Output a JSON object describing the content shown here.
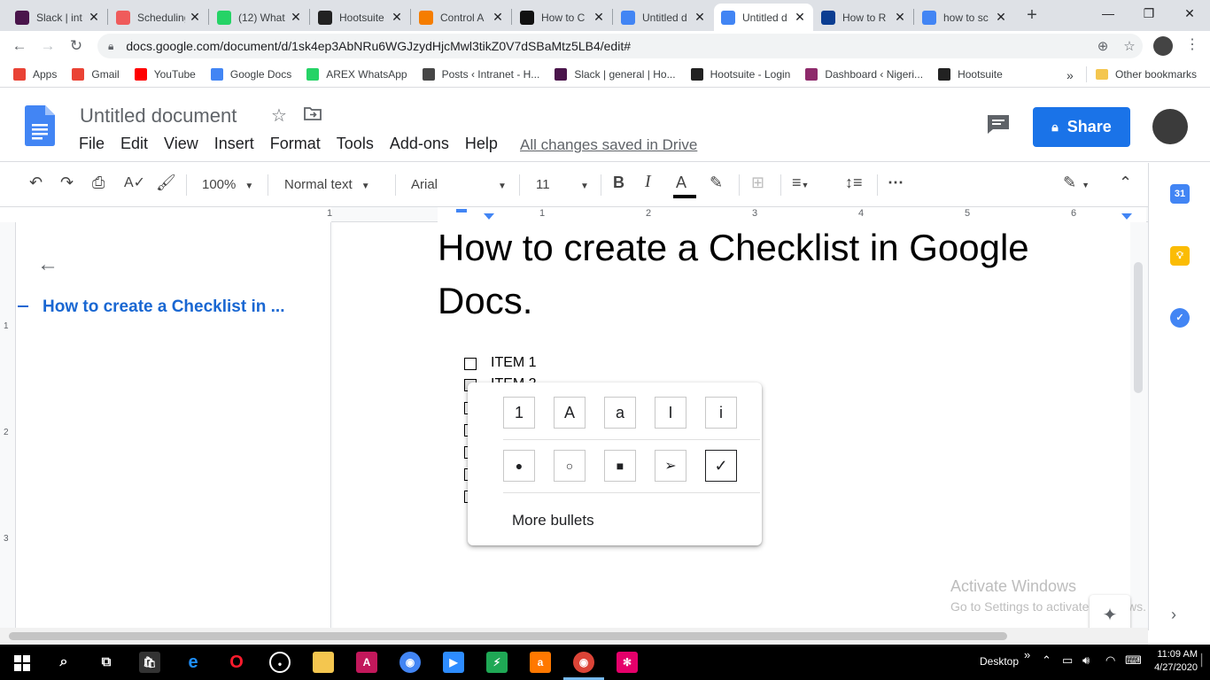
{
  "browser": {
    "tabs": [
      {
        "title": "Slack | int",
        "icon": "slack-icon",
        "color": "#4a154b"
      },
      {
        "title": "Scheduling",
        "icon": "scheduling-icon",
        "color": "#ef5b5b"
      },
      {
        "title": "(12) What",
        "icon": "whatsapp-icon",
        "color": "#25d366"
      },
      {
        "title": "Hootsuite",
        "icon": "hootsuite-icon",
        "color": "#222222"
      },
      {
        "title": "Control A",
        "icon": "blogger-icon",
        "color": "#f57d00"
      },
      {
        "title": "How to C",
        "icon": "htg-icon",
        "color": "#111111"
      },
      {
        "title": "Untitled d",
        "icon": "docs-icon",
        "color": "#4285f4"
      },
      {
        "title": "Untitled d",
        "icon": "docs-icon",
        "color": "#4285f4",
        "active": true
      },
      {
        "title": "How to R",
        "icon": "site-icon",
        "color": "#0b3d91"
      },
      {
        "title": "how to sc",
        "icon": "google-icon",
        "color": "#4285f4"
      }
    ],
    "url": "docs.google.com/document/d/1sk4ep3AbNRu6WGJzydHjcMwl3tikZ0V7dSBaMtz5LB4/edit#",
    "bookmarks": [
      {
        "label": "Apps",
        "icon": "apps-grid-icon",
        "color": "#e94235"
      },
      {
        "label": "Gmail",
        "icon": "gmail-icon",
        "color": "#ea4335"
      },
      {
        "label": "YouTube",
        "icon": "youtube-icon",
        "color": "#ff0000"
      },
      {
        "label": "Google Docs",
        "icon": "docs-icon",
        "color": "#4285f4"
      },
      {
        "label": "AREX WhatsApp",
        "icon": "whatsapp-icon",
        "color": "#25d366"
      },
      {
        "label": "Posts ‹ Intranet - H...",
        "icon": "wordpress-icon",
        "color": "#464646"
      },
      {
        "label": "Slack | general | Ho...",
        "icon": "slack-icon",
        "color": "#4a154b"
      },
      {
        "label": "Hootsuite - Login",
        "icon": "hootsuite-icon",
        "color": "#222222"
      },
      {
        "label": "Dashboard ‹ Nigeri...",
        "icon": "dashboard-icon",
        "color": "#8e2a6b"
      },
      {
        "label": "Hootsuite",
        "icon": "hootsuite-icon",
        "color": "#222222"
      }
    ],
    "bookmarks_overflow": "»",
    "other_bookmarks": "Other bookmarks"
  },
  "docs": {
    "title": "Untitled document",
    "menu": [
      "File",
      "Edit",
      "View",
      "Insert",
      "Format",
      "Tools",
      "Add-ons",
      "Help"
    ],
    "save_status": "All changes saved in Drive",
    "share_label": "Share",
    "toolbar": {
      "zoom": "100%",
      "style": "Normal text",
      "font": "Arial",
      "size": "11"
    },
    "ruler_numbers": [
      "1",
      "1",
      "2",
      "3",
      "4",
      "5",
      "6"
    ],
    "vruler_numbers": [
      "1",
      "2",
      "3"
    ],
    "outline": {
      "item": "How to create a Checklist in ..."
    },
    "heading": "How to create a Checklist in Google Docs.",
    "items": [
      "ITEM 1",
      "ITEM 2"
    ],
    "bullet_popup": {
      "row1": [
        "1",
        "A",
        "a",
        "I",
        "i"
      ],
      "row2": [
        "●",
        "○",
        "■",
        "➢",
        "✓"
      ],
      "selected": "✓",
      "more": "More bullets"
    },
    "side_panel": {
      "calendar_label": "31"
    }
  },
  "watermark": {
    "line1": "Activate Windows",
    "line2": "Go to Settings to activate Windows."
  },
  "taskbar": {
    "desktop_label": "Desktop",
    "time": "11:09 AM",
    "date": "4/27/2020"
  }
}
